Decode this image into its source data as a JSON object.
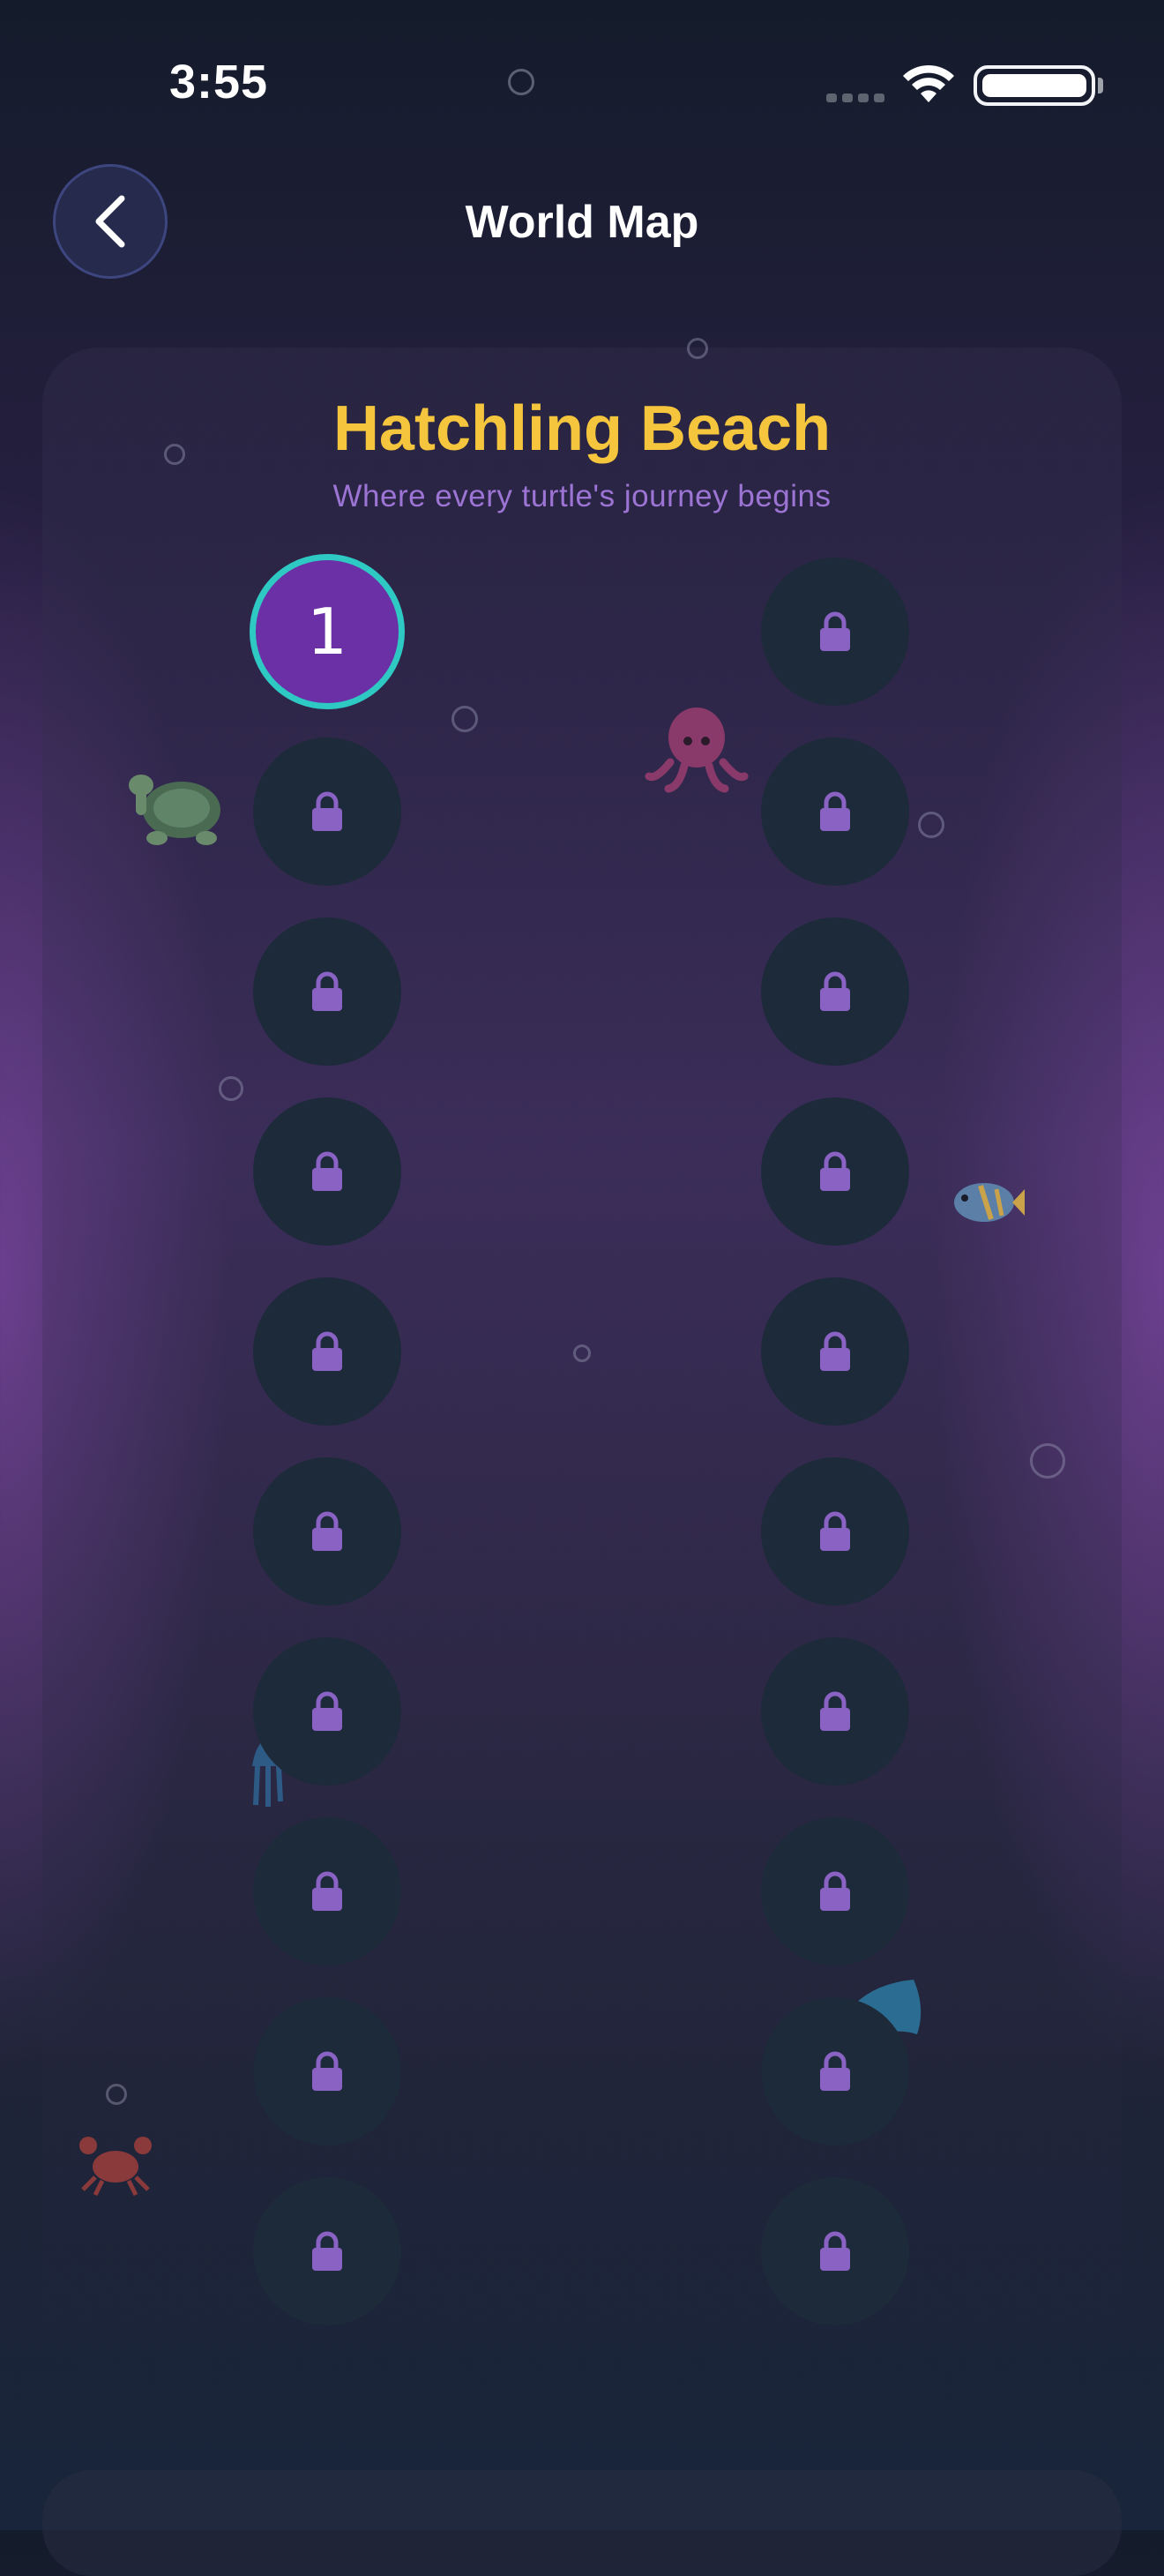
{
  "status_bar": {
    "time": "3:55"
  },
  "header": {
    "title": "World Map"
  },
  "world": {
    "title": "Hatchling Beach",
    "subtitle": "Where every turtle's journey begins"
  },
  "levels": {
    "current": "1",
    "locked_count": 19
  },
  "colors": {
    "title": "#f5c63d",
    "subtitle": "#9c74d4",
    "current_level_fill": "#6b2fa6",
    "current_level_ring": "#2fc9c4",
    "locked_node": "#1d2a3a",
    "lock_icon": "#8a62c4"
  },
  "icons": [
    "back-chevron-icon",
    "lock-icon",
    "turtle-icon",
    "octopus-icon",
    "fish-icon",
    "jellyfish-icon",
    "dolphin-icon",
    "crab-icon",
    "wifi-icon",
    "battery-icon"
  ]
}
